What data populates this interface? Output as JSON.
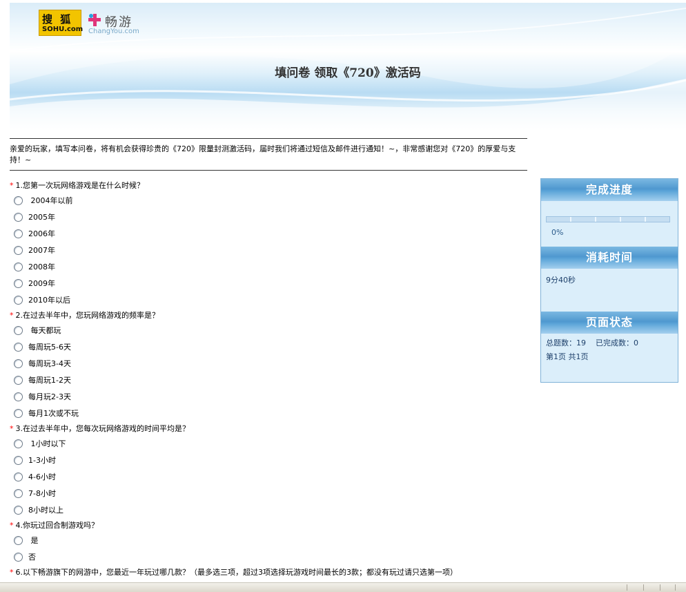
{
  "banner": {
    "sohu_logo_text": "搜 狐",
    "sohu_logo_domain": "SOHU.com",
    "changyou_name": "畅游",
    "changyou_domain": "ChangYou.com",
    "title": "填问卷  领取《720》激活码"
  },
  "intro": "亲爱的玩家，填写本问卷，将有机会获得珍贵的《720》限量封测激活码，届时我们将通过短信及邮件进行通知！~，非常感谢您对《720》的厚爱与支持！~",
  "required_mark": "*",
  "questions": [
    {
      "title": "1.您第一次玩网络游戏是在什么时候？",
      "options": [
        " 2004年以前",
        "2005年",
        "2006年",
        "2007年",
        "2008年",
        "2009年",
        "2010年以后"
      ]
    },
    {
      "title": "2.在过去半年中，您玩网络游戏的频率是？",
      "options": [
        " 每天都玩",
        "每周玩5-6天",
        "每周玩3-4天",
        "每周玩1-2天",
        "每月玩2-3天",
        "每月1次或不玩"
      ]
    },
    {
      "title": "3.在过去半年中，您每次玩网络游戏的时间平均是？",
      "options": [
        " 1小时以下",
        "1-3小时",
        "4-6小时",
        "7-8小时",
        "8小时以上"
      ]
    },
    {
      "title": "4.你玩过回合制游戏吗？",
      "options": [
        " 是",
        "否"
      ]
    },
    {
      "title": "6.以下畅游旗下的网游中，您最近一年玩过哪几款？（最多选三项，超过3项选择玩游戏时间最长的3款；都没有玩过请只选第一项）",
      "options": []
    }
  ],
  "sidebar": {
    "progress_title": "完成进度",
    "progress_value": 0,
    "progress_text": "0%",
    "time_title": "消耗时间",
    "time_value": "9分40秒",
    "status_title": "页面状态",
    "total_label": "总题数：19",
    "completed_label": "已完成数：0",
    "page_label": "第1页 共1页"
  },
  "colors": {
    "required": "#ff0000",
    "sidebar_header": "#4f98cf",
    "sidebar_bg": "#dbeefa",
    "sohu_yellow": "#f2c400"
  }
}
